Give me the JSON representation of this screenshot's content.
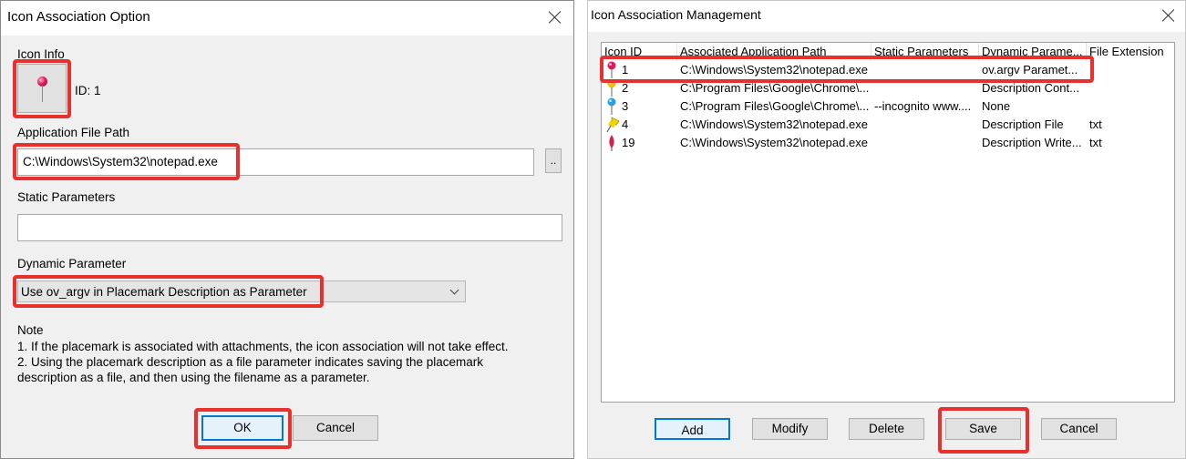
{
  "left_dialog": {
    "title": "Icon Association Option",
    "icon_info_label": "Icon Info",
    "icon_id_text": "ID: 1",
    "icon_name": "pink-pushpin-icon",
    "app_path_label": "Application File Path",
    "app_path_value": "C:\\Windows\\System32\\notepad.exe",
    "browse_label": "..",
    "static_params_label": "Static Parameters",
    "static_params_value": "",
    "dynamic_param_label": "Dynamic Parameter",
    "dynamic_param_value": "Use ov_argv in Placemark Description as Parameter",
    "note_title": "Note",
    "note_lines": [
      "1. If the placemark is associated with attachments, the icon association will not take effect.",
      "2. Using the placemark description as a file parameter indicates saving the placemark",
      "description as a file, and then using the filename as a parameter."
    ],
    "ok_label": "OK",
    "cancel_label": "Cancel"
  },
  "right_dialog": {
    "title": "Icon Association Management",
    "columns": [
      "Icon ID",
      "Associated Application Path",
      "Static Parameters",
      "Dynamic Parame...",
      "File Extension"
    ],
    "rows": [
      {
        "icon": "pink-pushpin-icon",
        "id": "1",
        "path": "C:\\Windows\\System32\\notepad.exe",
        "static": "",
        "dynamic": "ov.argv Paramet...",
        "ext": ""
      },
      {
        "icon": "yellow-pushpin-icon",
        "id": "2",
        "path": "C:\\Program Files\\Google\\Chrome\\...",
        "static": "",
        "dynamic": "Description Cont...",
        "ext": ""
      },
      {
        "icon": "blue-pushpin-icon",
        "id": "3",
        "path": "C:\\Program Files\\Google\\Chrome\\...",
        "static": "--incognito www....",
        "dynamic": "None",
        "ext": ""
      },
      {
        "icon": "yellow-thumbtack-icon",
        "id": "4",
        "path": "C:\\Windows\\System32\\notepad.exe",
        "static": "",
        "dynamic": "Description File",
        "ext": "txt"
      },
      {
        "icon": "red-marker-icon",
        "id": "19",
        "path": "C:\\Windows\\System32\\notepad.exe",
        "static": "",
        "dynamic": "Description Write...",
        "ext": "txt"
      }
    ],
    "add_label": "Add",
    "modify_label": "Modify",
    "delete_label": "Delete",
    "save_label": "Save",
    "cancel_label": "Cancel"
  },
  "colors": {
    "highlight": "#e8302e",
    "default_button_border": "#0078d7",
    "dialog_bg": "#f0f0f0"
  }
}
